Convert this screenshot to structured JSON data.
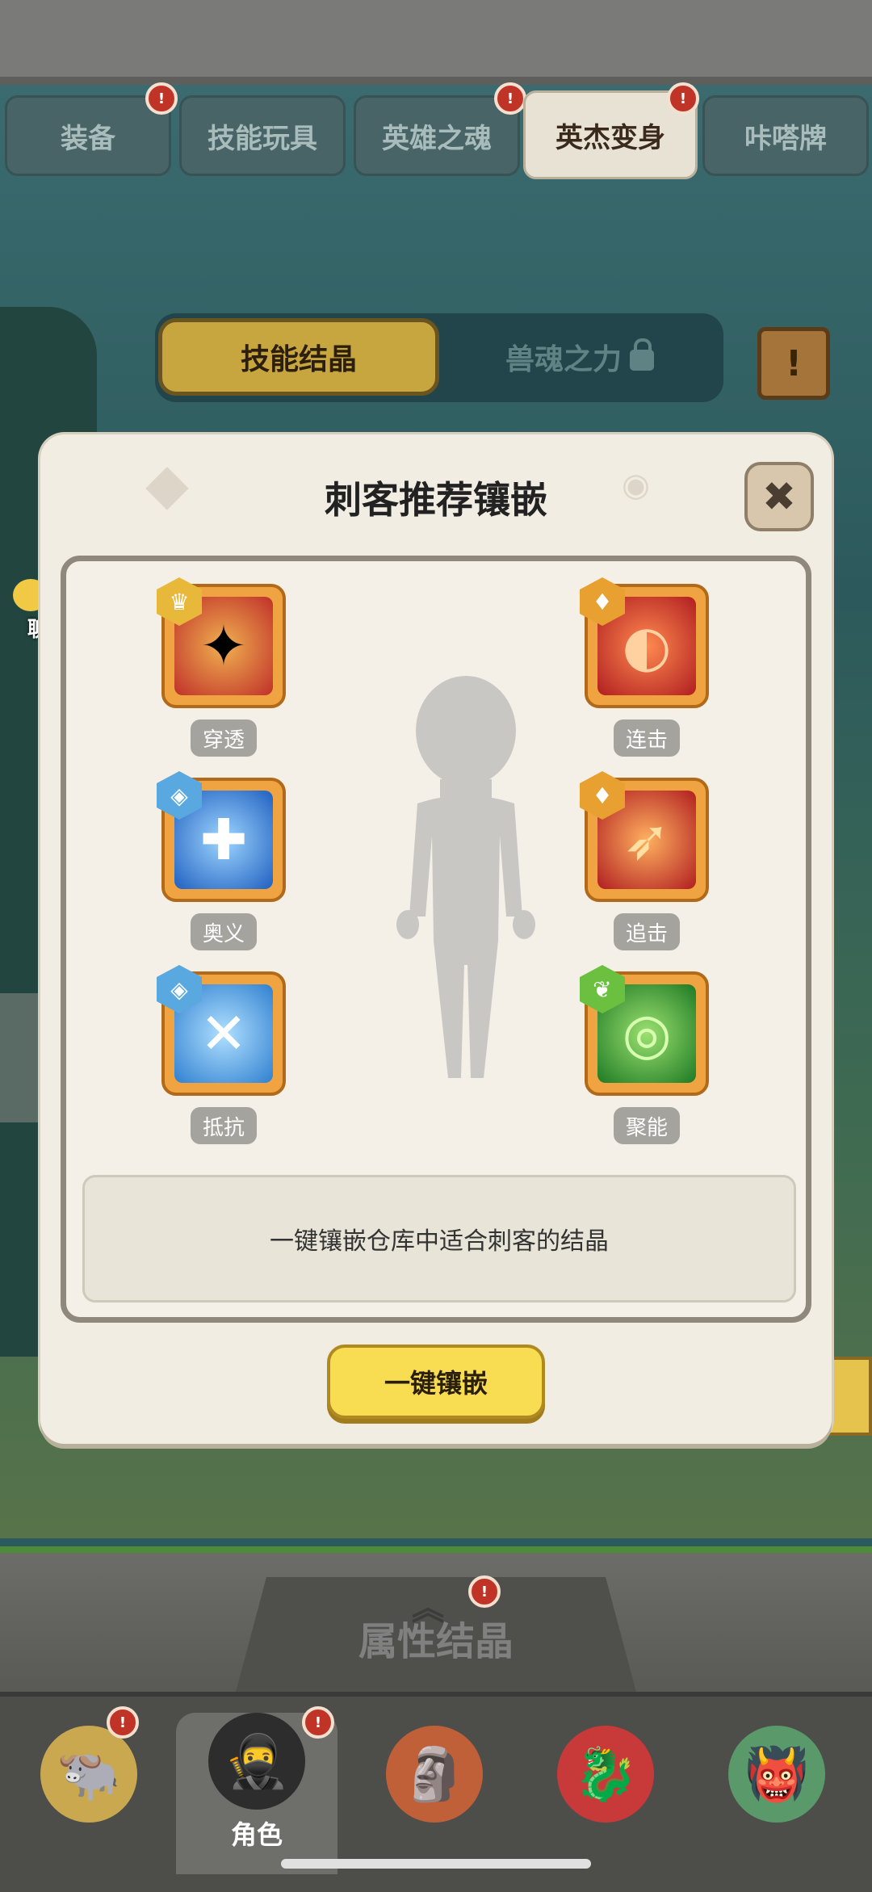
{
  "tabs": [
    {
      "label": "装备",
      "badge": true,
      "active": false
    },
    {
      "label": "技能玩具",
      "badge": false,
      "active": false
    },
    {
      "label": "英雄之魂",
      "badge": true,
      "active": false
    },
    {
      "label": "英杰变身",
      "badge": true,
      "active": true
    },
    {
      "label": "咔嗒牌",
      "badge": false,
      "active": false
    }
  ],
  "subtabs": {
    "skill_crystal": "技能结晶",
    "beast_soul": "兽魂之力"
  },
  "chat": {
    "label": "聊天"
  },
  "modal": {
    "title": "刺客推荐镶嵌",
    "close_icon": "✖",
    "gems": [
      {
        "label": "穿透",
        "color": "#d9473a",
        "badge_color": "#e8b83a",
        "badge_icon": "crown"
      },
      {
        "label": "连击",
        "color": "#d43630",
        "badge_color": "#e8a030",
        "badge_icon": "sword"
      },
      {
        "label": "奥义",
        "color": "#2f7fd6",
        "badge_color": "#5aa8e0",
        "badge_icon": "shield"
      },
      {
        "label": "追击",
        "color": "#d43630",
        "badge_color": "#e8a030",
        "badge_icon": "sword"
      },
      {
        "label": "抵抗",
        "color": "#3a8fd8",
        "badge_color": "#5aa8e0",
        "badge_icon": "shield"
      },
      {
        "label": "聚能",
        "color": "#3aa838",
        "badge_color": "#6cc040",
        "badge_icon": "leaf"
      }
    ],
    "info_text": "一键镶嵌仓库中适合刺客的结晶",
    "inlay_button": "一键镶嵌"
  },
  "attribute_bar": {
    "label": "属性结晶",
    "badge": true
  },
  "bottom_nav": [
    {
      "label": "",
      "icon": "yak-hero-icon",
      "badge": true,
      "active": false
    },
    {
      "label": "角色",
      "icon": "ninja-hero-icon",
      "badge": true,
      "active": true
    },
    {
      "label": "",
      "icon": "totem-hero-icon",
      "badge": false,
      "active": false
    },
    {
      "label": "",
      "icon": "dragon-hero-icon",
      "badge": false,
      "active": false
    },
    {
      "label": "",
      "icon": "tiki-hero-icon",
      "badge": false,
      "active": false
    }
  ]
}
